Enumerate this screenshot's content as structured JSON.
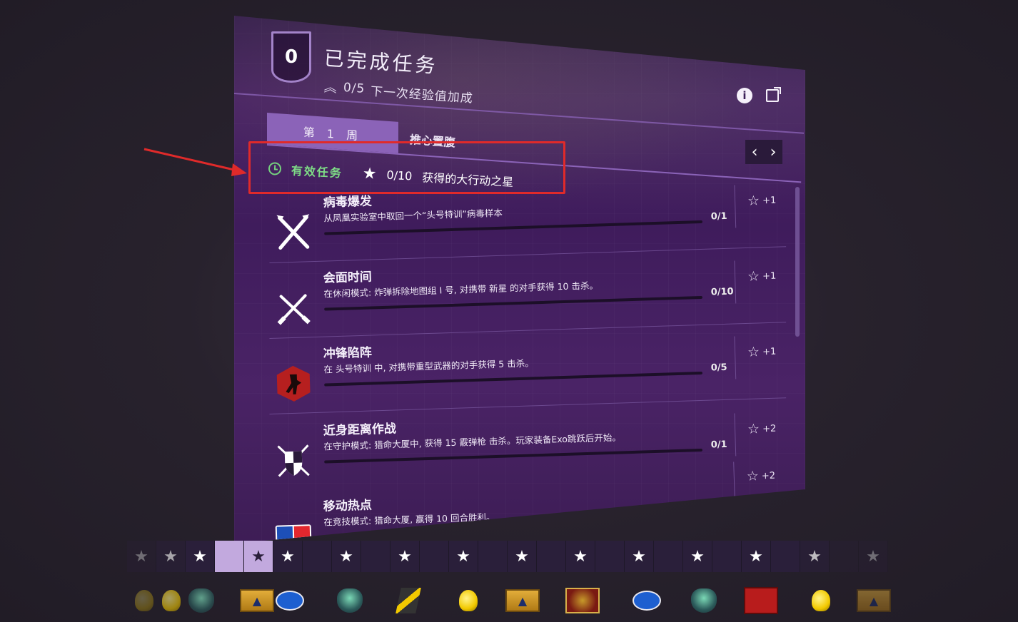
{
  "header": {
    "rank": "0",
    "title": "已完成任务",
    "xp_progress": "0/5",
    "xp_label": "下一次经验值加成"
  },
  "tabs": {
    "week_tab": "第 1 周",
    "second_tab": "推心置腹"
  },
  "active": {
    "label": "有效任务",
    "stars_count": "0/10",
    "stars_label": "获得的大行动之星"
  },
  "missions": [
    {
      "title": "病毒爆发",
      "desc": "从凤凰实验室中取回一个“头号特训”病毒样本",
      "progress": "0/1",
      "reward": "+1",
      "icon": "crossed-swords-icon"
    },
    {
      "title": "会面时间",
      "desc": "在休闲模式: 炸弹拆除地图组 I 号, 对携带 新星 的对手获得 10 击杀。",
      "progress": "0/10",
      "reward": "+1",
      "icon": "crossed-knives-icon"
    },
    {
      "title": "冲锋陷阵",
      "desc": "在 头号特训 中, 对携带重型武器的对手获得 5 击杀。",
      "progress": "0/5",
      "reward": "+1",
      "icon": "terrorist-badge-icon"
    },
    {
      "title": "近身距离作战",
      "desc": "在守护模式: 猎命大厦中, 获得 15 霰弹枪 击杀。玩家装备Exo跳跃后开始。",
      "progress": "0/1",
      "reward": "+2",
      "icon": "shield-swords-icon"
    },
    {
      "title": "移动热点",
      "desc": "在竞技模式: 猎命大厦, 赢得 10 回合胜利。",
      "progress": "",
      "reward": "+2",
      "icon": "competitive-badge-icon"
    }
  ],
  "colors": {
    "panel": "#4b2566",
    "accent": "#8b63b8",
    "active_green": "#7edc86",
    "highlight_red": "#e02a2a"
  },
  "star_track": {
    "cells": [
      "★",
      "★",
      "★",
      "",
      "★",
      "★",
      "",
      "★",
      "",
      "★",
      "",
      "★",
      "",
      "★",
      "",
      "★",
      "",
      "★",
      "",
      "★",
      "",
      "★",
      "",
      "★",
      "",
      "★"
    ]
  }
}
